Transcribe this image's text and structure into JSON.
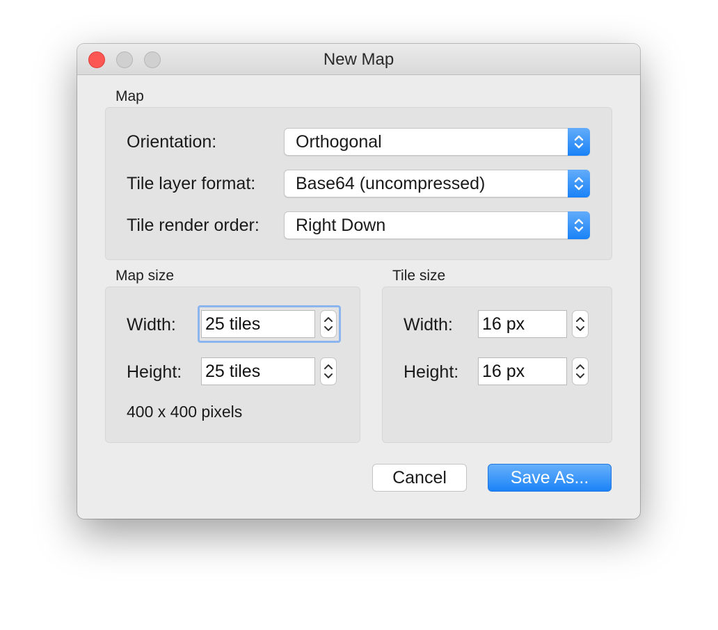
{
  "window": {
    "title": "New Map"
  },
  "map_group": {
    "label": "Map",
    "orientation": {
      "label": "Orientation:",
      "value": "Orthogonal"
    },
    "tile_layer_format": {
      "label": "Tile layer format:",
      "value": "Base64 (uncompressed)"
    },
    "tile_render_order": {
      "label": "Tile render order:",
      "value": "Right Down"
    }
  },
  "map_size": {
    "label": "Map size",
    "width": {
      "label": "Width:",
      "value": "25 tiles"
    },
    "height": {
      "label": "Height:",
      "value": "25 tiles"
    },
    "pixels": "400 x 400 pixels"
  },
  "tile_size": {
    "label": "Tile size",
    "width": {
      "label": "Width:",
      "value": "16 px"
    },
    "height": {
      "label": "Height:",
      "value": "16 px"
    }
  },
  "buttons": {
    "cancel": "Cancel",
    "save_as": "Save As..."
  },
  "colors": {
    "accent": "#1a82f7",
    "close_button": "#fc5753",
    "focus_ring": "#8cb5ef"
  }
}
